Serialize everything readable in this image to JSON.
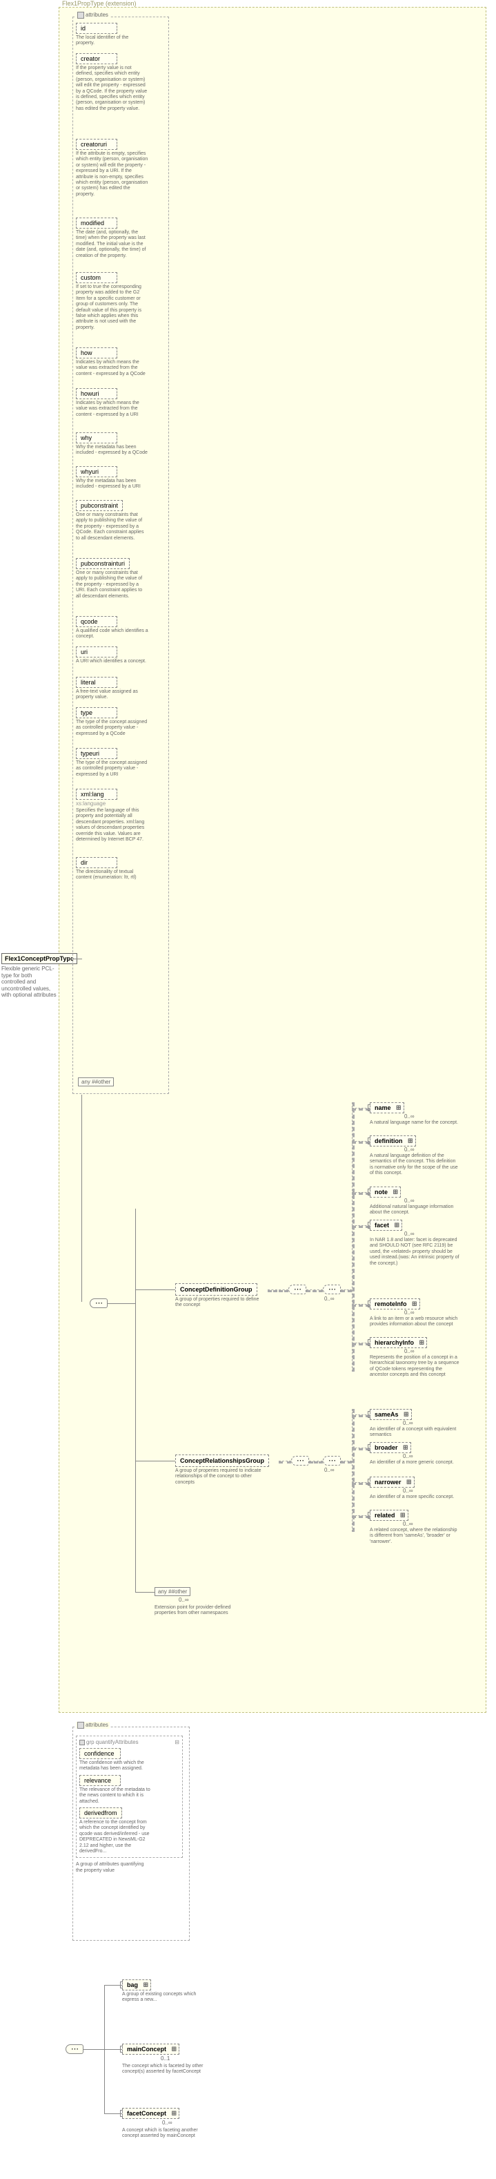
{
  "ext": {
    "label": "Flex1PropType (extension)"
  },
  "root": {
    "name": "Flex1ConceptPropType",
    "desc": "Flexible generic PCL-type for both controlled and uncontrolled values, with optional attributes"
  },
  "attributes_label": "attributes",
  "attrs": [
    {
      "name": "id",
      "desc": "The local identifier of the property."
    },
    {
      "name": "creator",
      "desc": "If the property value is not defined, specifies which entity (person, organisation or system) will edit the property - expressed by a QCode. If the property value is defined, specifies which entity (person, organisation or system) has edited the property value."
    },
    {
      "name": "creatoruri",
      "desc": "If the attribute is empty, specifies which entity (person, organisation or system) will edit the property - expressed by a URI. If the attribute is non-empty, specifies which entity (person, organisation or system) has edited the property."
    },
    {
      "name": "modified",
      "desc": "The date (and, optionally, the time) when the property was last modified. The initial value is the date (and, optionally, the time) of creation of the property."
    },
    {
      "name": "custom",
      "desc": "If set to true the corresponding property was added to the G2 Item for a specific customer or group of customers only. The default value of this property is false which applies when this attribute is not used with the property."
    },
    {
      "name": "how",
      "desc": "Indicates by which means the value was extracted from the content - expressed by a QCode"
    },
    {
      "name": "howuri",
      "desc": "Indicates by which means the value was extracted from the content - expressed by a URI"
    },
    {
      "name": "why",
      "desc": "Why the metadata has been included - expressed by a QCode"
    },
    {
      "name": "whyuri",
      "desc": "Why the metadata has been included - expressed by a URI"
    },
    {
      "name": "pubconstraint",
      "desc": "One or many constraints that apply to publishing the value of the property - expressed by a QCode. Each constraint applies to all descendant elements."
    },
    {
      "name": "pubconstrainturi",
      "desc": "One or many constraints that apply to publishing the value of the property - expressed by a URI. Each constraint applies to all descendant elements."
    },
    {
      "name": "qcode",
      "desc": "A qualified code which identifies a concept."
    },
    {
      "name": "uri",
      "desc": "A URI which identifies a concept."
    },
    {
      "name": "literal",
      "desc": "A free-text value assigned as property value."
    },
    {
      "name": "type",
      "desc": "The type of the concept assigned as controlled property value - expressed by a QCode"
    },
    {
      "name": "typeuri",
      "desc": "The type of the concept assigned as controlled property value - expressed by a URI"
    },
    {
      "name": "xml:lang",
      "desc": "Specifies the language of this property and potentially all descendant properties. xml:lang values of descendant properties override this value. Values are determined by Internet BCP 47.",
      "type": "xs:language"
    },
    {
      "name": "dir",
      "desc": "The directionality of textual content (enumeration: ltr, rtl)"
    }
  ],
  "any_other_attr": "any ##other",
  "cseq_label": "⋯",
  "groups": {
    "def": {
      "name": "ConceptDefinitionGroup",
      "desc": "A group of properties required to define the concept"
    },
    "rel": {
      "name": "ConceptRelationshipsGroup",
      "desc": "A group of properies required to indicate relationships of the concept to other concepts"
    }
  },
  "def_children": [
    {
      "name": "name",
      "desc": "A natural language name for the concept."
    },
    {
      "name": "definition",
      "desc": "A natural language definition of the semantics of the concept. This definition is normative only for the scope of the use of this concept."
    },
    {
      "name": "note",
      "desc": "Additional natural language information about the concept."
    },
    {
      "name": "facet",
      "desc": "In NAR 1.8 and later: facet is deprecated and SHOULD NOT (see RFC 2119) be used, the «related» property should be used instead.(was: An intrinsic property of the concept.)"
    },
    {
      "name": "remoteInfo",
      "desc": "A link to an item or a web resource which provides information about the concept"
    },
    {
      "name": "hierarchyInfo",
      "desc": "Represents the position of a concept in a hierarchical taxonomy tree by a sequence of QCode tokens representing the ancestor concepts and this concept"
    }
  ],
  "rel_children": [
    {
      "name": "sameAs",
      "desc": "An identifier of a concept with equivalent semantics"
    },
    {
      "name": "broader",
      "desc": "An identifier of a more generic concept."
    },
    {
      "name": "narrower",
      "desc": "An identifier of a more specific concept."
    },
    {
      "name": "related",
      "desc": "A related concept, where the relationship is different from 'sameAs', 'broader' or 'narrower'."
    }
  ],
  "any_other_elem": {
    "label": "any ##other",
    "occur": "0..∞",
    "desc": "Extension point for provider-defined properties from other namespaces"
  },
  "qa": {
    "container": "attributes",
    "group": "grp quantifyAttributes",
    "items": [
      {
        "name": "confidence",
        "desc": "The confidence with which the metadata has been assigned."
      },
      {
        "name": "relevance",
        "desc": "The relevance of the metadata to the news content to which it is attached."
      },
      {
        "name": "derivedfrom",
        "desc": "A reference to the concept from which the concept identified by qcode was derived/inferred - use DEPRECATED in NewsML-G2 2.12 and higher, use the derivedFro..."
      }
    ],
    "group_desc": "A group of attributes quantifying the property value"
  },
  "bottom": {
    "bag": {
      "name": "bag",
      "desc": "A group of existing concepts which express a new..."
    },
    "mainConcept": {
      "name": "mainConcept",
      "desc": "The concept which is faceted by other concept(s) asserted by facetConcept",
      "occur": "0..1"
    },
    "facetConcept": {
      "name": "facetConcept",
      "desc": "A concept which is faceting another concept asserted by mainConcept",
      "occur": "0..∞"
    }
  },
  "zero_inf": "0..∞",
  "zero_one": "0..1"
}
